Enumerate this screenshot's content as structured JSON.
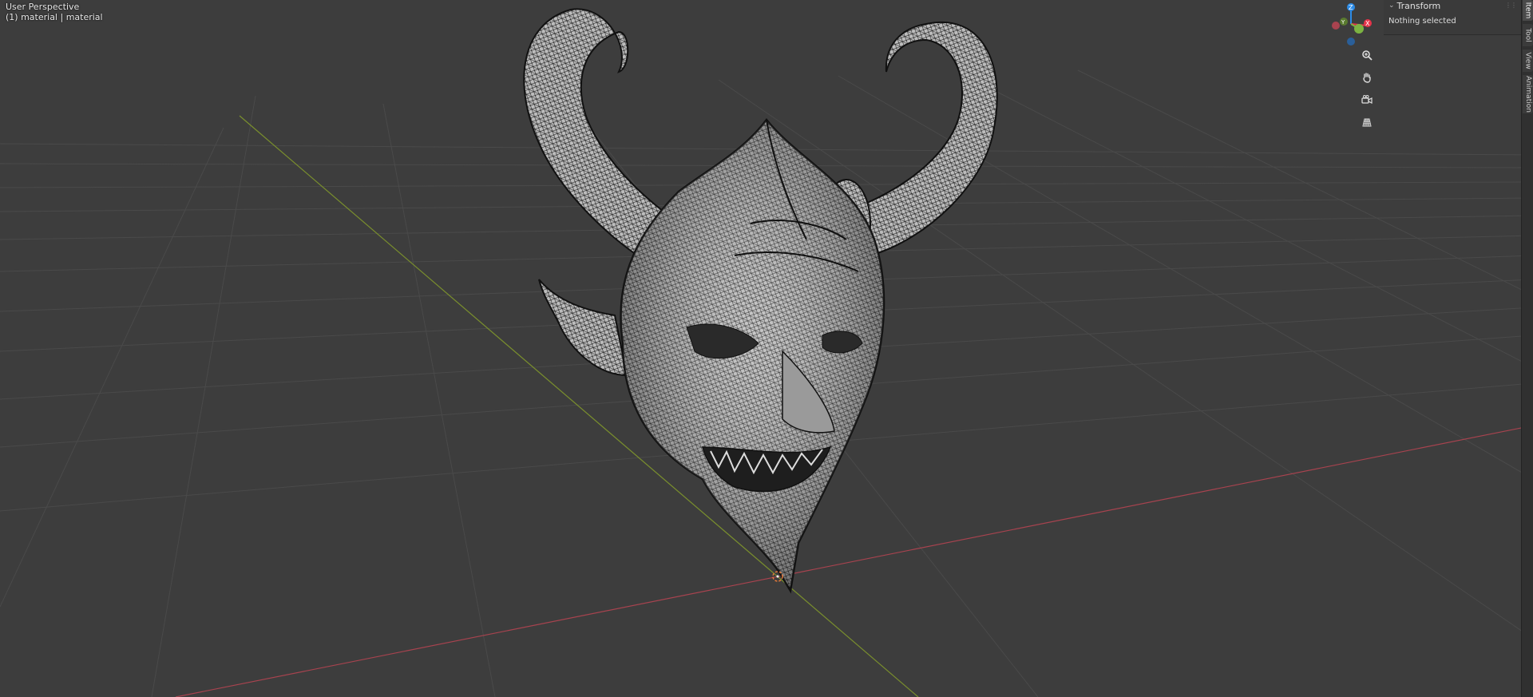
{
  "viewport": {
    "view_name": "User Perspective",
    "object_info": "(1) material | material"
  },
  "gizmo": {
    "z_label": "Z",
    "y_label": "Y",
    "x_label": "X",
    "x_color": "#e6344a",
    "y_color": "#7cb342",
    "z_color": "#2c8be6"
  },
  "nav_tools": [
    "zoom-icon",
    "hand-pan-icon",
    "camera-icon",
    "grid-perspective-icon"
  ],
  "sidebar": {
    "panel_title": "Transform",
    "panel_content": "Nothing selected",
    "tabs": [
      "Item",
      "Tool",
      "View",
      "Animation"
    ],
    "active_tab": "Item"
  },
  "axes": {
    "x_axis_color": "#a8434f",
    "y_axis_color": "#7a8f2d"
  }
}
